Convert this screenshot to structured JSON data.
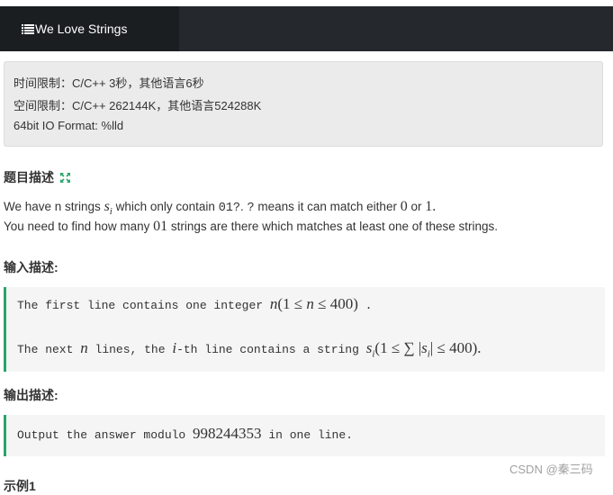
{
  "header": {
    "title": "We Love Strings",
    "icon": "list-icon",
    "bar_color": "#25292d",
    "tab_color": "#1b1e21"
  },
  "limits": {
    "time": "时间限制：C/C++ 3秒，其他语言6秒",
    "space": "空间限制：C/C++ 262144K，其他语言524288K",
    "format": "64bit IO Format: %lld"
  },
  "problem": {
    "title": "题目描述",
    "expand_icon": "expand-icon",
    "desc_line1": {
      "p1": "We have n strings ",
      "var": "s",
      "sub": "i",
      "p2": " which only contain ",
      "code1": "01?",
      "p3": ". ",
      "code2": "?",
      "p4": " means it can match either ",
      "m1": "0",
      "p5": " or ",
      "m2": "1",
      "p6": "."
    },
    "desc_line2": {
      "p1": "You need to find how many ",
      "m1": "01",
      "p2": " strings are there which matches at least one of these strings."
    }
  },
  "input": {
    "title": "输入描述:",
    "line1": {
      "text": "The first line contains one integer ",
      "math_var": "n",
      "math_rest": "(1 ≤ ",
      "math_var2": "n",
      "math_end": " ≤ 400)",
      "tail": " ."
    },
    "line2": {
      "t1": "The next ",
      "m_n": "n",
      "t2": " lines, the ",
      "m_i": "i",
      "t3": "-th line contains a string ",
      "m_s": "s",
      "m_sub": "i",
      "m_expr": "(1 ≤ ∑ |",
      "m_s2": "s",
      "m_sub2": "i",
      "m_tail": "| ≤ 400)",
      "t4": "."
    }
  },
  "output": {
    "title": "输出描述:",
    "line": {
      "t1": "Output the answer modulo ",
      "m": "998244353",
      "t2": " in one line."
    }
  },
  "next_section": "示例1",
  "watermark": "CSDN @秦三码",
  "accent_color": "#26a66b"
}
